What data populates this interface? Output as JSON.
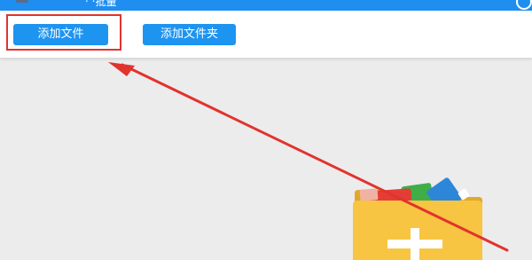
{
  "title_bar": {
    "title": "‧ ‧批量"
  },
  "toolbar": {
    "add_file_label": "添加文件",
    "add_folder_label": "添加文件夹"
  },
  "colors": {
    "accent": "#1e94f1",
    "annotation": "#e2332e",
    "canvas": "#ececec",
    "folder": "#f7c542"
  },
  "icons": [
    "app-icon",
    "folder-add-icon",
    "plus-icon",
    "annotation-arrow"
  ]
}
